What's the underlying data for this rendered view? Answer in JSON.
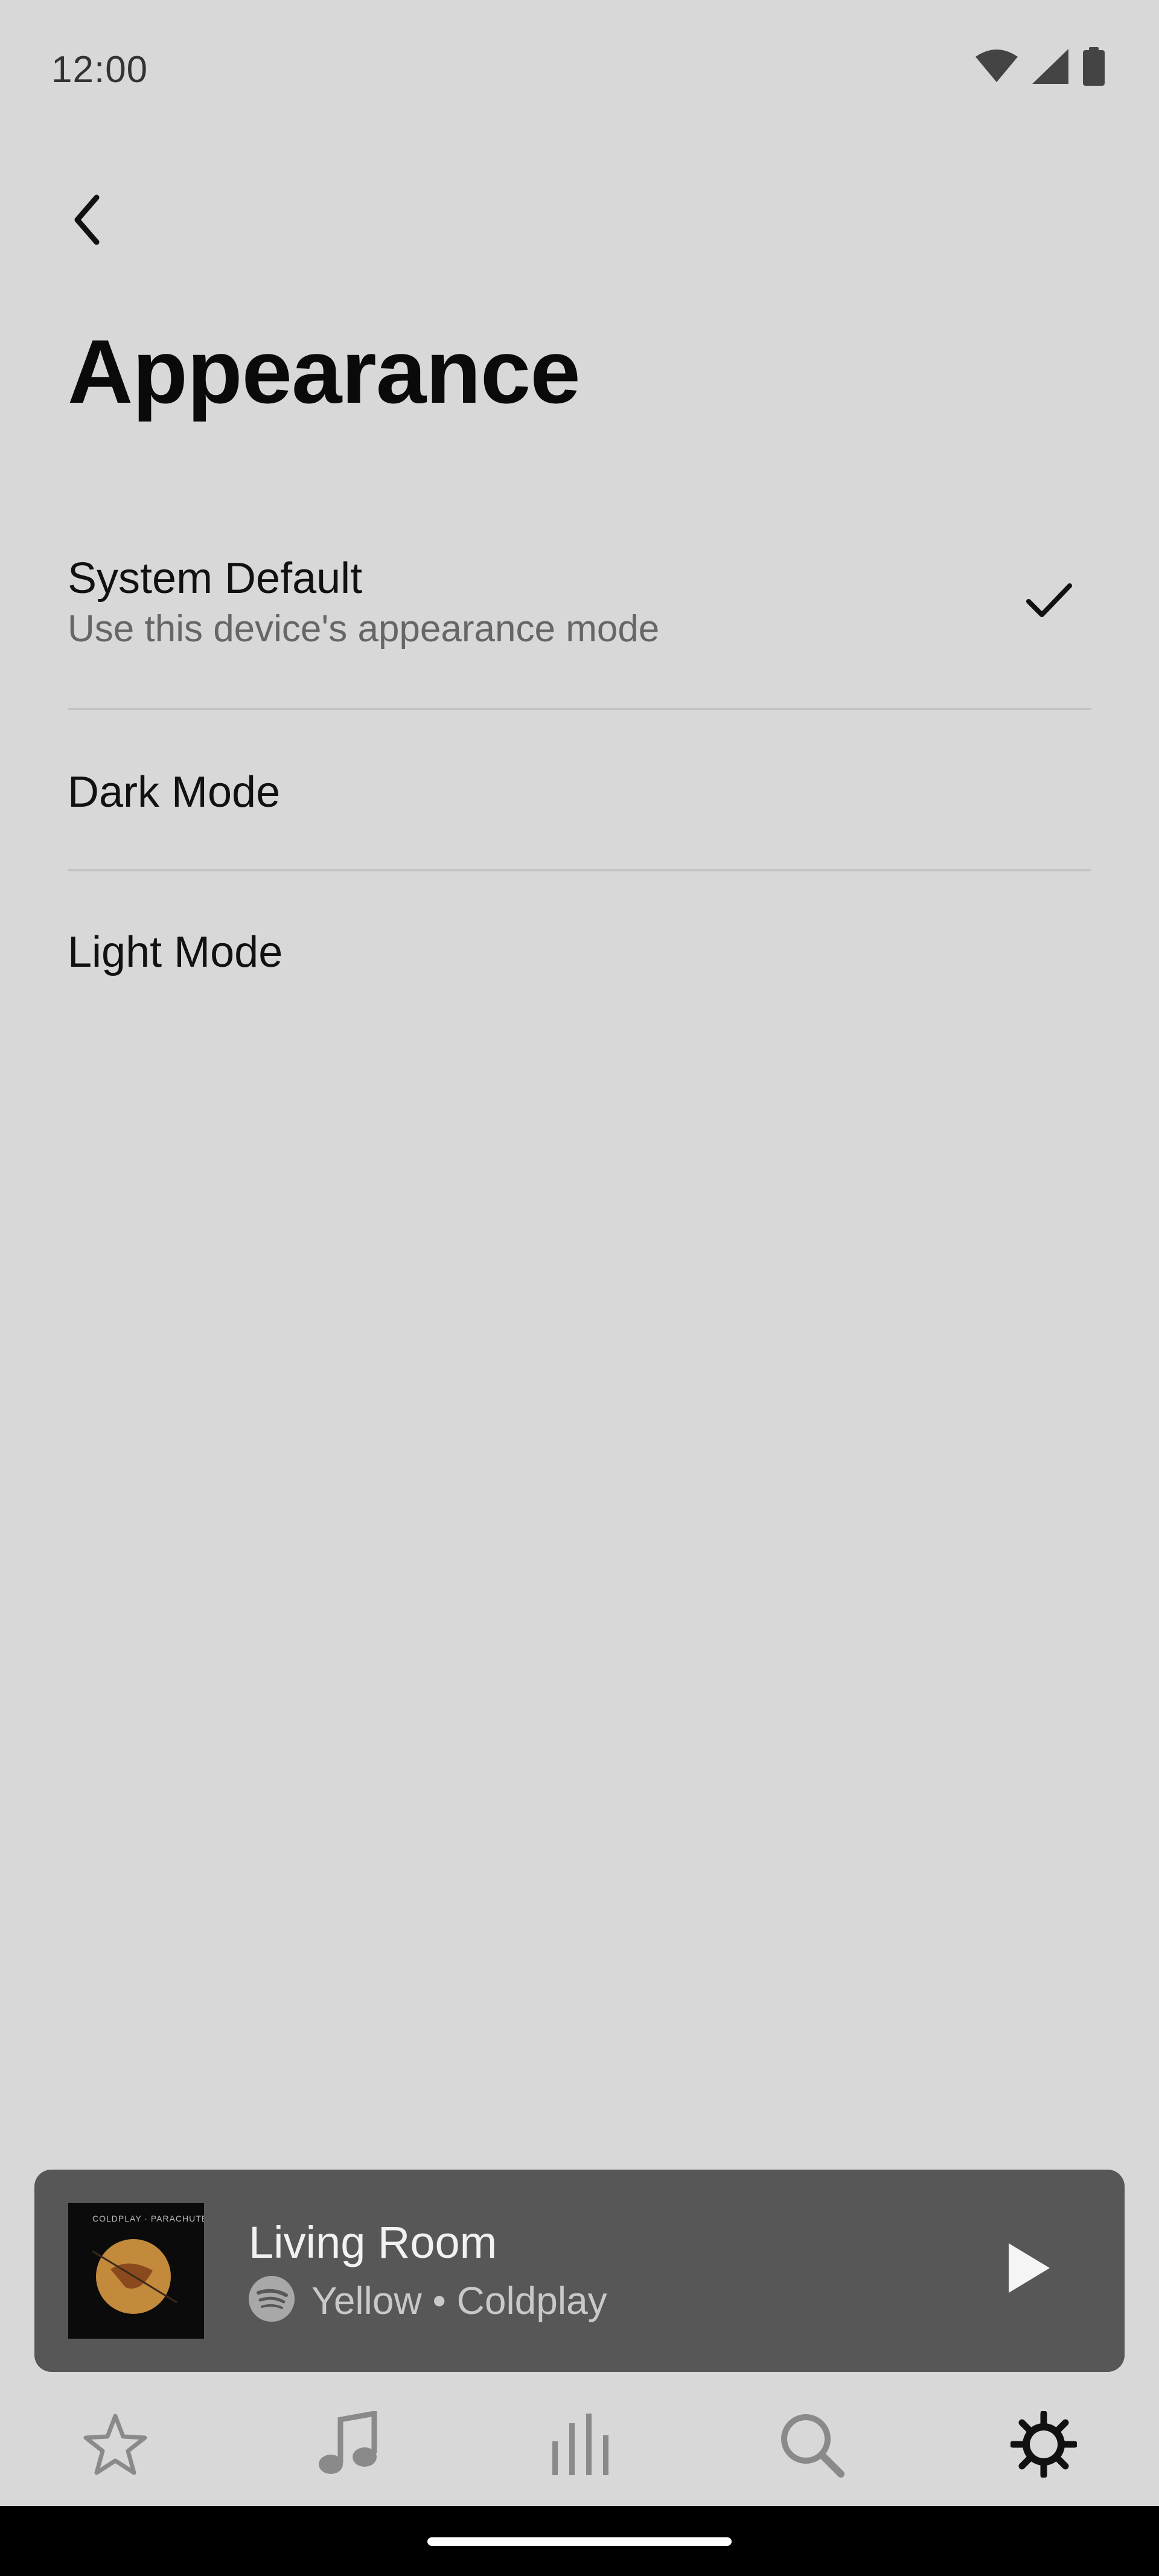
{
  "status_bar": {
    "time": "12:00",
    "icons": [
      "wifi-icon",
      "signal-icon",
      "battery-icon"
    ]
  },
  "header": {
    "back_icon": "chevron-left-icon",
    "title": "Appearance"
  },
  "options": [
    {
      "label": "System Default",
      "subtitle": "Use this device's appearance mode",
      "selected": true
    },
    {
      "label": "Dark Mode",
      "selected": false
    },
    {
      "label": "Light Mode",
      "selected": false
    }
  ],
  "now_playing": {
    "room": "Living Room",
    "source_icon": "spotify-icon",
    "track": "Yellow • Coldplay",
    "album_art_text": "COLDPLAY · PARACHUTES",
    "play_icon": "play-icon"
  },
  "tab_bar": {
    "tabs": [
      {
        "name": "favorites",
        "icon": "star-icon",
        "active": false
      },
      {
        "name": "music",
        "icon": "music-note-icon",
        "active": false
      },
      {
        "name": "rooms",
        "icon": "equalizer-icon",
        "active": false
      },
      {
        "name": "search",
        "icon": "search-icon",
        "active": false
      },
      {
        "name": "settings",
        "icon": "gear-icon",
        "active": true
      }
    ]
  },
  "colors": {
    "background": "#d8d8d8",
    "player_background": "#575757",
    "divider": "#c4c4c4",
    "inactive_tab": "#8a8a8a",
    "active_tab": "#111111"
  }
}
